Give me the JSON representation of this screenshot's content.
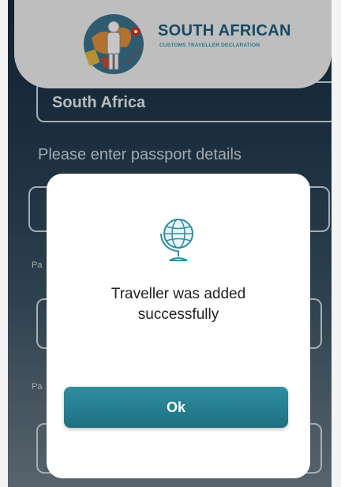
{
  "header": {
    "brand_title": "SOUTH AFRICAN",
    "brand_subtitle": "CUSTOMS TRAVELLER DECLARATION",
    "logo_icon": "traveller-globe-logo"
  },
  "form": {
    "country_value": "South Africa",
    "section_title": "Please enter passport details",
    "label_1": "Pa",
    "label_2": "Pa"
  },
  "dialog": {
    "icon": "globe-icon",
    "message_line1": "Traveller was added",
    "message_line2": "successfully",
    "ok_label": "Ok"
  },
  "colors": {
    "brand_blue": "#1e5a7a",
    "accent_teal": "#2e8fa0",
    "header_bg": "#e8e8e8"
  }
}
